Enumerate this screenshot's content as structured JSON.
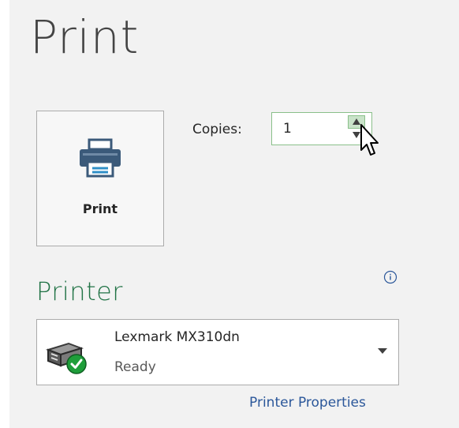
{
  "page": {
    "title": "Print"
  },
  "print_button": {
    "label": "Print",
    "icon": "printer-icon"
  },
  "copies": {
    "label": "Copies:",
    "value": "1"
  },
  "printer_section": {
    "heading": "Printer",
    "info_icon": "info-icon",
    "selected_printer": {
      "name": "Lexmark MX310dn",
      "status": "Ready",
      "icon": "printer-ready-icon"
    },
    "properties_link": "Printer Properties"
  },
  "colors": {
    "accent": "#217346",
    "link": "#2b579a",
    "panel_bg": "#f2f2f2"
  }
}
